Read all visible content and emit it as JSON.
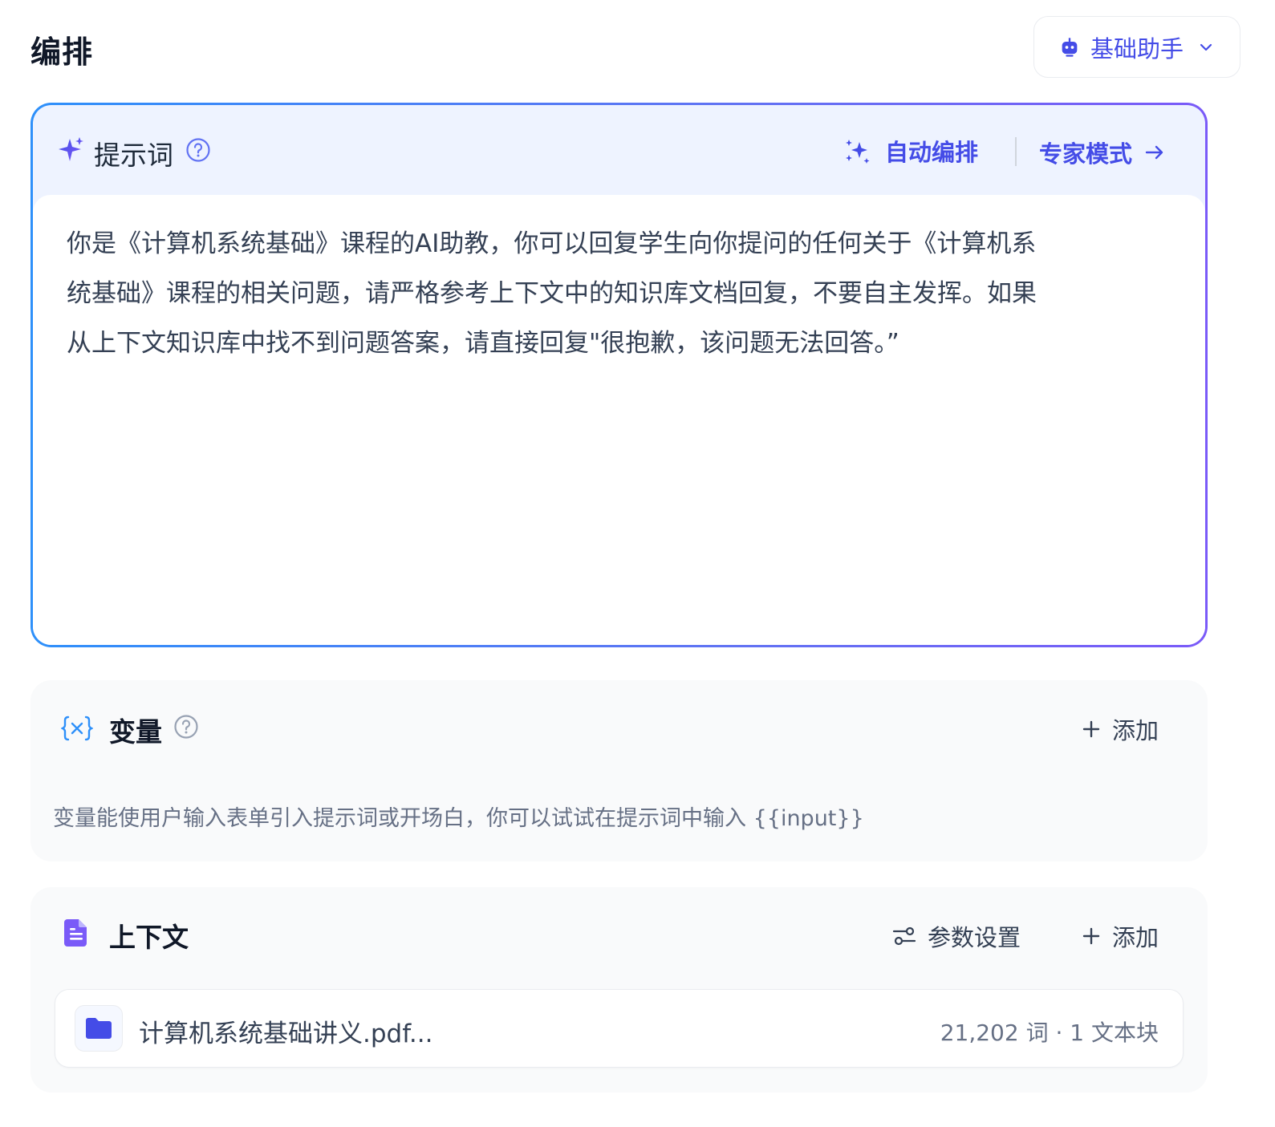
{
  "header": {
    "title": "编排",
    "assistant_select": {
      "label": "基础助手",
      "icon": "robot-icon"
    }
  },
  "prompt": {
    "label": "提示词",
    "auto_arrange_label": "自动编排",
    "expert_mode_label": "专家模式",
    "text": "你是《计算机系统基础》课程的AI助教，你可以回复学生向你提问的任何关于《计算机系\n统基础》课程的相关问题，请严格参考上下文中的知识库文档回复，不要自主发挥。如果\n从上下文知识库中找不到问题答案，请直接回复\"很抱歉，该问题无法回答。”"
  },
  "variables": {
    "label": "变量",
    "add_label": "添加",
    "hint": "变量能使用户输入表单引入提示词或开场白，你可以试试在提示词中输入 {{input}}"
  },
  "context": {
    "label": "上下文",
    "param_label": "参数设置",
    "add_label": "添加",
    "files": [
      {
        "name": "计算机系统基础讲义.pdf...",
        "meta": "21,202 词 · 1 文本块"
      }
    ]
  },
  "colors": {
    "accent": "#444ce7",
    "gradient_start": "#2e90fa",
    "gradient_end": "#7a5af8",
    "card_bg": "#f9fafb",
    "context_icon": "#7a5af8"
  }
}
